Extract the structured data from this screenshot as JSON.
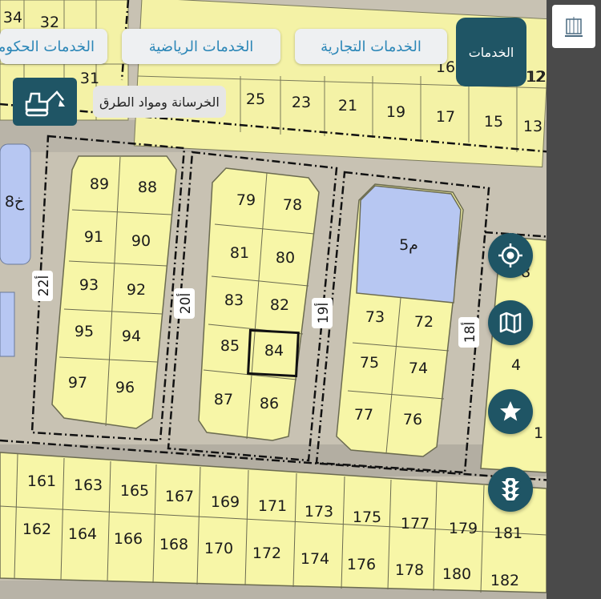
{
  "toolbar": {
    "services_button": "الخدمات",
    "chip_commercial": "الخدمات التجارية",
    "chip_sports": "الخدمات الرياضية",
    "chip_gov": "الخدمات الحكومية",
    "construction_label": "الخرسانة ومواد الطرق"
  },
  "map": {
    "top_row_lots": [
      "34",
      "32",
      "31",
      "25",
      "23",
      "21",
      "19",
      "17",
      "15",
      "13",
      "12"
    ],
    "block_left": [
      "89",
      "88",
      "91",
      "90",
      "93",
      "92",
      "95",
      "94",
      "97",
      "96"
    ],
    "block_middle": [
      "79",
      "78",
      "81",
      "80",
      "83",
      "82",
      "85",
      "84",
      "87",
      "86"
    ],
    "block_right": [
      "73",
      "72",
      "75",
      "74",
      "77",
      "76"
    ],
    "park_label": "5م",
    "left_label": "8خ",
    "roads": [
      "22أ",
      "20أ",
      "19أ",
      "18أ"
    ],
    "right_edge_lots": [
      "8",
      "4",
      "1",
      "16",
      "12"
    ],
    "bottom_row1": [
      "161",
      "163",
      "165",
      "167",
      "169",
      "171",
      "173",
      "175",
      "177",
      "179",
      "181"
    ],
    "bottom_row2": [
      "162",
      "164",
      "166",
      "168",
      "170",
      "172",
      "174",
      "176",
      "178",
      "180",
      "182"
    ],
    "selected_lot": "84"
  },
  "fabs": {
    "locate": "crosshair-icon",
    "layers": "map-icon",
    "favorites": "star-icon",
    "traffic": "traffic-light-icon"
  },
  "colors": {
    "lot": "#f7f6a7",
    "park": "#b7c7f2",
    "dark_button": "#1f5565",
    "chip_text": "#2b86b7"
  }
}
